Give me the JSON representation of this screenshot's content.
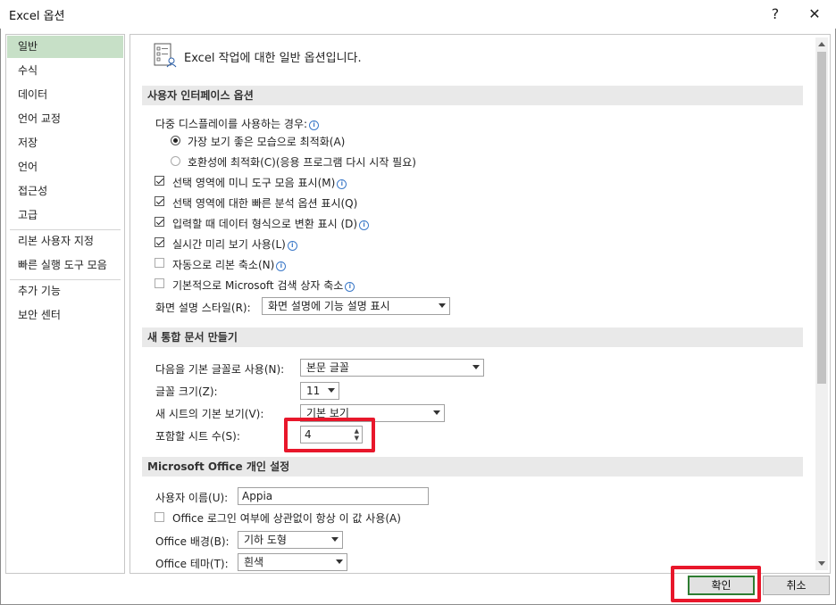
{
  "window": {
    "title": "Excel 옵션",
    "help_glyph": "?",
    "close_glyph": "✕"
  },
  "nav": {
    "items": [
      {
        "label": "일반",
        "selected": true
      },
      {
        "label": "수식"
      },
      {
        "label": "데이터"
      },
      {
        "label": "언어 교정"
      },
      {
        "label": "저장"
      },
      {
        "label": "언어"
      },
      {
        "label": "접근성"
      },
      {
        "label": "고급"
      },
      {
        "label": "리본 사용자 지정"
      },
      {
        "label": "빠른 실행 도구 모음"
      },
      {
        "label": "추가 기능"
      },
      {
        "label": "보안 센터"
      }
    ]
  },
  "header": {
    "text": "Excel 작업에 대한 일반 옵션입니다."
  },
  "ui_options": {
    "section_title": "사용자 인터페이스 옵션",
    "multi_display_label": "다중 디스플레이를 사용하는 경우:",
    "radio_best_appearance": {
      "label": "가장 보기 좋은 모습으로 최적화(A)",
      "checked": true
    },
    "radio_compat": {
      "label": "호환성에 최적화(C)(응용 프로그램 다시 시작 필요)",
      "checked": false
    },
    "cb_mini_toolbar": {
      "label": "선택 영역에 미니 도구 모음 표시(M)",
      "checked": true
    },
    "cb_quick_analysis": {
      "label": "선택 영역에 대한 빠른 분석 옵션 표시(Q)",
      "checked": true
    },
    "cb_convert_format": {
      "label": "입력할 때 데이터 형식으로 변환 표시 (D)",
      "checked": true
    },
    "cb_live_preview": {
      "label": "실시간 미리 보기 사용(L)",
      "checked": true
    },
    "cb_collapse_ribbon": {
      "label": "자동으로 리본 축소(N)",
      "checked": false
    },
    "cb_collapse_search": {
      "label": "기본적으로 Microsoft 검색 상자 축소",
      "checked": false
    },
    "screentip_label": "화면 설명 스타일(R):",
    "screentip_value": "화면 설명에 기능 설명 표시"
  },
  "new_workbook": {
    "section_title": "새 통합 문서 만들기",
    "font_label": "다음을 기본 글꼴로 사용(N):",
    "font_value": "본문 글꼴",
    "size_label": "글꼴 크기(Z):",
    "size_value": "11",
    "view_label": "새 시트의 기본 보기(V):",
    "view_value": "기본 보기",
    "sheets_label": "포함할 시트 수(S):",
    "sheets_value": "4"
  },
  "personalize": {
    "section_title": "Microsoft Office 개인 설정",
    "username_label": "사용자 이름(U):",
    "username_value": "Appia",
    "cb_always_use": {
      "label": "Office 로그인 여부에 상관없이 항상 이 값 사용(A)",
      "checked": false
    },
    "background_label": "Office 배경(B):",
    "background_value": "기하 도형",
    "theme_label": "Office 테마(T):",
    "theme_value": "흰색"
  },
  "footer": {
    "ok_label": "확인",
    "cancel_label": "취소"
  },
  "colors": {
    "nav_selected": "#c7e0c7",
    "highlight": "#e8172b",
    "section_bg": "#e9e9e9",
    "ok_border": "#2e7d32"
  }
}
